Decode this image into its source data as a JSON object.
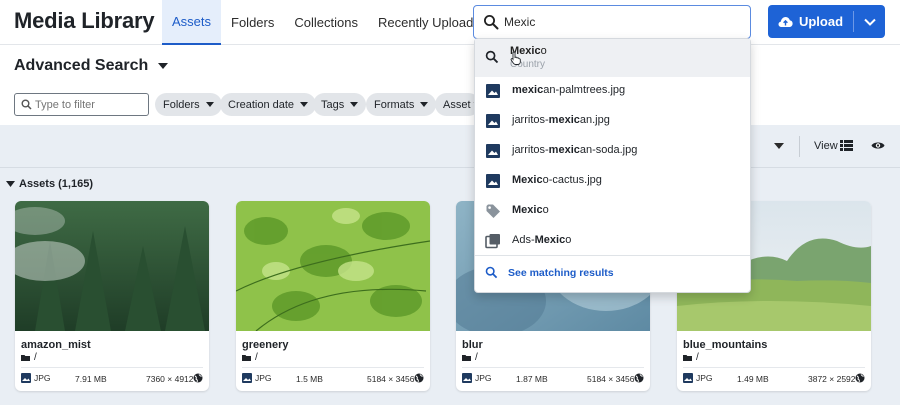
{
  "header": {
    "app_title": "Media Library",
    "tabs": [
      {
        "label": "Assets",
        "active": true
      },
      {
        "label": "Folders",
        "active": false
      },
      {
        "label": "Collections",
        "active": false
      },
      {
        "label": "Recently Uploaded",
        "active": false
      }
    ],
    "search": {
      "value": "Mexic",
      "icon": "search-icon"
    },
    "upload": {
      "label": "Upload",
      "icon": "cloud-upload-icon"
    }
  },
  "filters": {
    "title": "Advanced Search",
    "filter_placeholder": "Type to filter",
    "chips": [
      "Folders",
      "Creation date",
      "Tags",
      "Formats",
      "Asset ty"
    ]
  },
  "toolbar": {
    "view_label": "View"
  },
  "assets": {
    "header": "Assets (1,165)",
    "cards": [
      {
        "name": "amazon_mist",
        "path": "/",
        "format": "JPG",
        "size": "7.91 MB",
        "dims": "7360 × 4912"
      },
      {
        "name": "greenery",
        "path": "/",
        "format": "JPG",
        "size": "1.5 MB",
        "dims": "5184 × 3456"
      },
      {
        "name": "blur",
        "path": "/",
        "format": "JPG",
        "size": "1.87 MB",
        "dims": "5184 × 3456"
      },
      {
        "name": "blue_mountains",
        "path": "/",
        "format": "JPG",
        "size": "1.49 MB",
        "dims": "3872 × 2592"
      }
    ]
  },
  "dropdown": {
    "first": {
      "bold": "Mexic",
      "rest": "o",
      "sub": "Country"
    },
    "items": [
      {
        "pre": "",
        "bold": "mexic",
        "post": "an-palmtrees.jpg",
        "icon": "image-icon"
      },
      {
        "pre": "jarritos-",
        "bold": "mexic",
        "post": "an.jpg",
        "icon": "image-icon"
      },
      {
        "pre": "jarritos-",
        "bold": "mexic",
        "post": "an-soda.jpg",
        "icon": "image-icon"
      },
      {
        "pre": "",
        "bold": "Mexic",
        "post": "o-cactus.jpg",
        "icon": "image-icon"
      },
      {
        "pre": "",
        "bold": "Mexic",
        "post": "o",
        "icon": "tag-icon"
      },
      {
        "pre": "Ads-",
        "bold": "Mexic",
        "post": "o",
        "icon": "collection-icon"
      }
    ],
    "see_more": "See matching results"
  },
  "colors": {
    "accent": "#1e63d6",
    "band": "#e9eef4"
  }
}
